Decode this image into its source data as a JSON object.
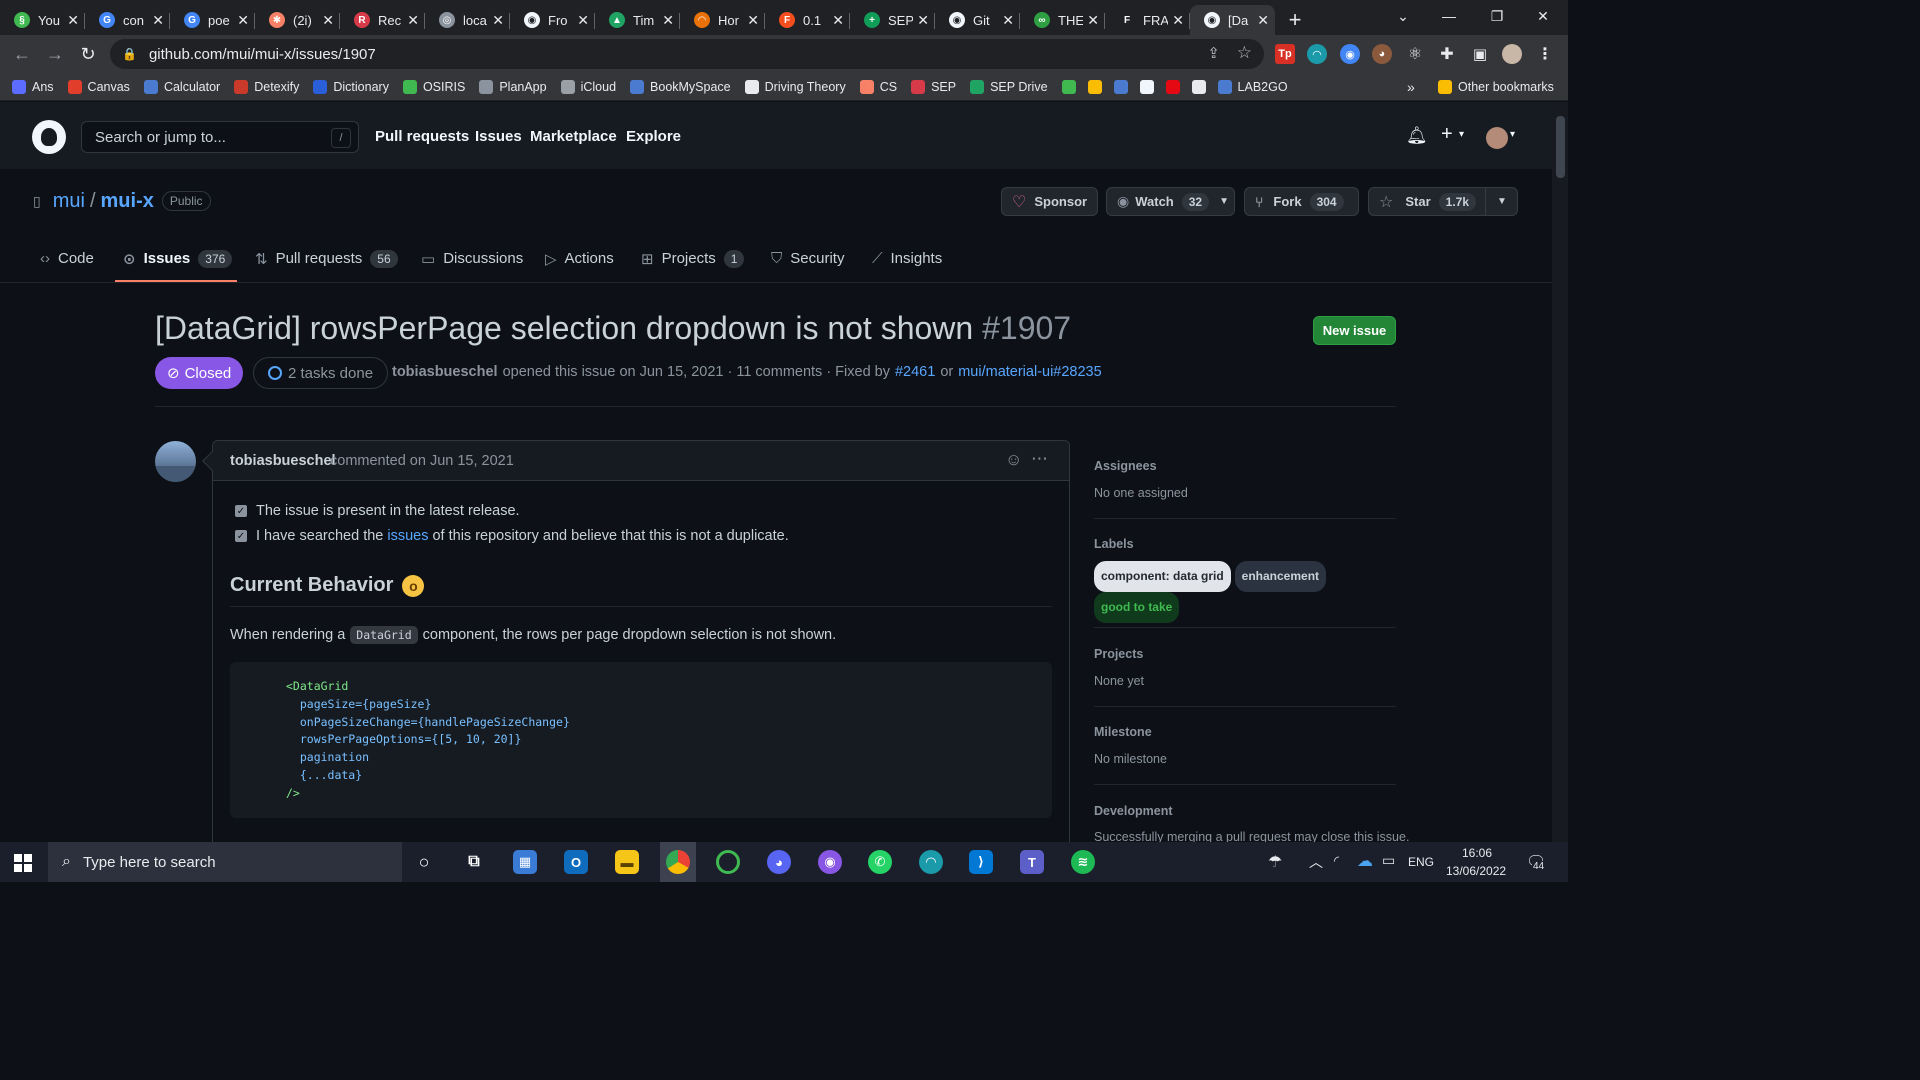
{
  "browser": {
    "tabs": [
      {
        "title": "You",
        "color": "#3fb950",
        "glyph": "§"
      },
      {
        "title": "con",
        "color": "#4285f4",
        "glyph": "G"
      },
      {
        "title": "poe",
        "color": "#4285f4",
        "glyph": "G"
      },
      {
        "title": "(2i)",
        "color": "#f78166",
        "glyph": "✱"
      },
      {
        "title": "Rec",
        "color": "#d73a49",
        "glyph": "R"
      },
      {
        "title": "loca",
        "color": "#8b949e",
        "glyph": "◎"
      },
      {
        "title": "Fro",
        "color": "#f0f6fc",
        "glyph": "◉"
      },
      {
        "title": "Tim",
        "color": "#1fa463",
        "glyph": "▲"
      },
      {
        "title": "Hor",
        "color": "#e8710a",
        "glyph": "◠"
      },
      {
        "title": "0.1",
        "color": "#f24e1e",
        "glyph": "F"
      },
      {
        "title": "SEP",
        "color": "#0f9d58",
        "glyph": "+"
      },
      {
        "title": "Git",
        "color": "#f0f6fc",
        "glyph": "◉"
      },
      {
        "title": "THE",
        "color": "#2ea043",
        "glyph": "∞"
      },
      {
        "title": "FRA",
        "color": "#202124",
        "glyph": "F"
      },
      {
        "title": "[Da",
        "color": "#f0f6fc",
        "glyph": "◉"
      }
    ],
    "new_tab": "+",
    "url": "github.com/mui/mui-x/issues/1907",
    "bookmarks": [
      {
        "label": "Ans",
        "color": "#5b6cff"
      },
      {
        "label": "Canvas",
        "color": "#e13f2b"
      },
      {
        "label": "Calculator",
        "color": "#4a7bd0"
      },
      {
        "label": "Detexify",
        "color": "#c93a2a"
      },
      {
        "label": "Dictionary",
        "color": "#2b5fd9"
      },
      {
        "label": "OSIRIS",
        "color": "#3fb950"
      },
      {
        "label": "PlanApp",
        "color": "#8b949e"
      },
      {
        "label": "iCloud",
        "color": "#9aa0a6"
      },
      {
        "label": "BookMySpace",
        "color": "#4a7bd0"
      },
      {
        "label": "Driving Theory",
        "color": "#e8eaed"
      },
      {
        "label": "CS",
        "color": "#f78166"
      },
      {
        "label": "SEP",
        "color": "#d73a49"
      },
      {
        "label": "SEP Drive",
        "color": "#1fa463"
      },
      {
        "label": "",
        "color": "#3fb950"
      },
      {
        "label": "",
        "color": "#fbbc04"
      },
      {
        "label": "",
        "color": "#4a7bd0"
      },
      {
        "label": "",
        "color": "#f0f6fc"
      },
      {
        "label": "",
        "color": "#e50914"
      },
      {
        "label": "",
        "color": "#e8eaed"
      },
      {
        "label": "LAB2GO",
        "color": "#4a7bd0"
      }
    ],
    "more_bookmarks": "»",
    "other_bookmarks": "Other bookmarks"
  },
  "github": {
    "search_placeholder": "Search or jump to...",
    "search_shortcut": "/",
    "nav": [
      "Pull requests",
      "Issues",
      "Marketplace",
      "Explore"
    ],
    "plus": "+"
  },
  "repo": {
    "owner": "mui",
    "sep": "/",
    "name": "mui-x",
    "visibility": "Public",
    "sponsor_label": "Sponsor",
    "watch_label": "Watch",
    "watch_count": "32",
    "fork_label": "Fork",
    "fork_count": "304",
    "star_label": "Star",
    "star_count": "1.7k",
    "tabs": [
      {
        "label": "Code",
        "count": ""
      },
      {
        "label": "Issues",
        "count": "376"
      },
      {
        "label": "Pull requests",
        "count": "56"
      },
      {
        "label": "Discussions",
        "count": ""
      },
      {
        "label": "Actions",
        "count": ""
      },
      {
        "label": "Projects",
        "count": "1"
      },
      {
        "label": "Security",
        "count": ""
      },
      {
        "label": "Insights",
        "count": ""
      }
    ]
  },
  "issue": {
    "title": "[DataGrid] rowsPerPage selection dropdown is not shown",
    "number": "#1907",
    "new_issue_label": "New issue",
    "state": "Closed",
    "tasks": "2 tasks done",
    "author": "tobiasbueschel",
    "meta_opened": "opened this issue on Jun 15, 2021 · 11 comments · Fixed by",
    "fix1": "#2461",
    "meta_or": "or",
    "fix2": "mui/material-ui#28235"
  },
  "comment": {
    "author": "tobiasbueschel",
    "meta": "commented on Jun 15, 2021",
    "checklist": [
      {
        "text": "The issue is present in the latest release.",
        "checked": true
      },
      {
        "pre": "I have searched the",
        "link": "issues",
        "post": "of this repository and believe that this is not a duplicate.",
        "checked": true
      }
    ],
    "heading": "Current Behavior",
    "heading_emoji": "😯",
    "para_pre": "When rendering a",
    "para_code": "DataGrid",
    "para_post": "component, the rows per page dropdown selection is not shown.",
    "code_lines": [
      "<DataGrid",
      "  pageSize={pageSize}",
      "  onPageSizeChange={handlePageSizeChange}",
      "  rowsPerPageOptions={[5, 10, 20]}",
      "  pagination",
      "  {...data}",
      "/>"
    ]
  },
  "sidebar": {
    "assignees_title": "Assignees",
    "assignees_value": "No one assigned",
    "labels_title": "Labels",
    "labels": [
      {
        "text": "component: data grid",
        "bg": "#e1e4e8",
        "fg": "#24292f"
      },
      {
        "text": "enhancement",
        "bg": "#2b3340",
        "fg": "#c9d1d9"
      },
      {
        "text": "good to take",
        "bg": "#0f3a1c",
        "fg": "#3fb950"
      }
    ],
    "projects_title": "Projects",
    "projects_value": "None yet",
    "milestone_title": "Milestone",
    "milestone_value": "No milestone",
    "development_title": "Development",
    "development_value": "Successfully merging a pull request may close this issue."
  },
  "taskbar": {
    "search_placeholder": "Type here to search",
    "lang": "ENG",
    "time": "16:06",
    "date": "13/06/2022",
    "notifications": "44"
  },
  "colors": {
    "accent_link": "#58a6ff",
    "closed_purple": "#8957e5",
    "new_issue_green": "#238636",
    "tab_underline": "#f78166"
  }
}
